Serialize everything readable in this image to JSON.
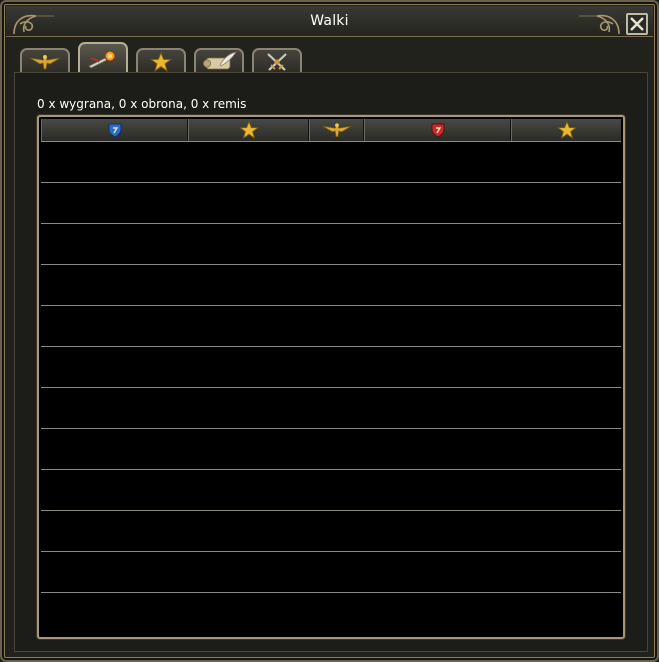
{
  "window": {
    "title": "Walki"
  },
  "tabs": [
    {
      "icon": "golden-eagle-icon",
      "active": false
    },
    {
      "icon": "winged-sword-icon",
      "active": true
    },
    {
      "icon": "gold-star-icon",
      "active": false
    },
    {
      "icon": "scroll-quill-icon",
      "active": false
    },
    {
      "icon": "crossed-swords-icon",
      "active": false
    }
  ],
  "summary": "0 x wygrana, 0 x obrona, 0 x remis",
  "table": {
    "columns": [
      {
        "icon": "blue-shield-icon"
      },
      {
        "icon": "gold-star-icon"
      },
      {
        "icon": "golden-eagle-icon"
      },
      {
        "icon": "red-shield-icon"
      },
      {
        "icon": "gold-star-icon"
      }
    ],
    "rows": []
  },
  "colors": {
    "accent": "#c8a04a",
    "border": "#a8987a",
    "text": "#ffffff"
  }
}
